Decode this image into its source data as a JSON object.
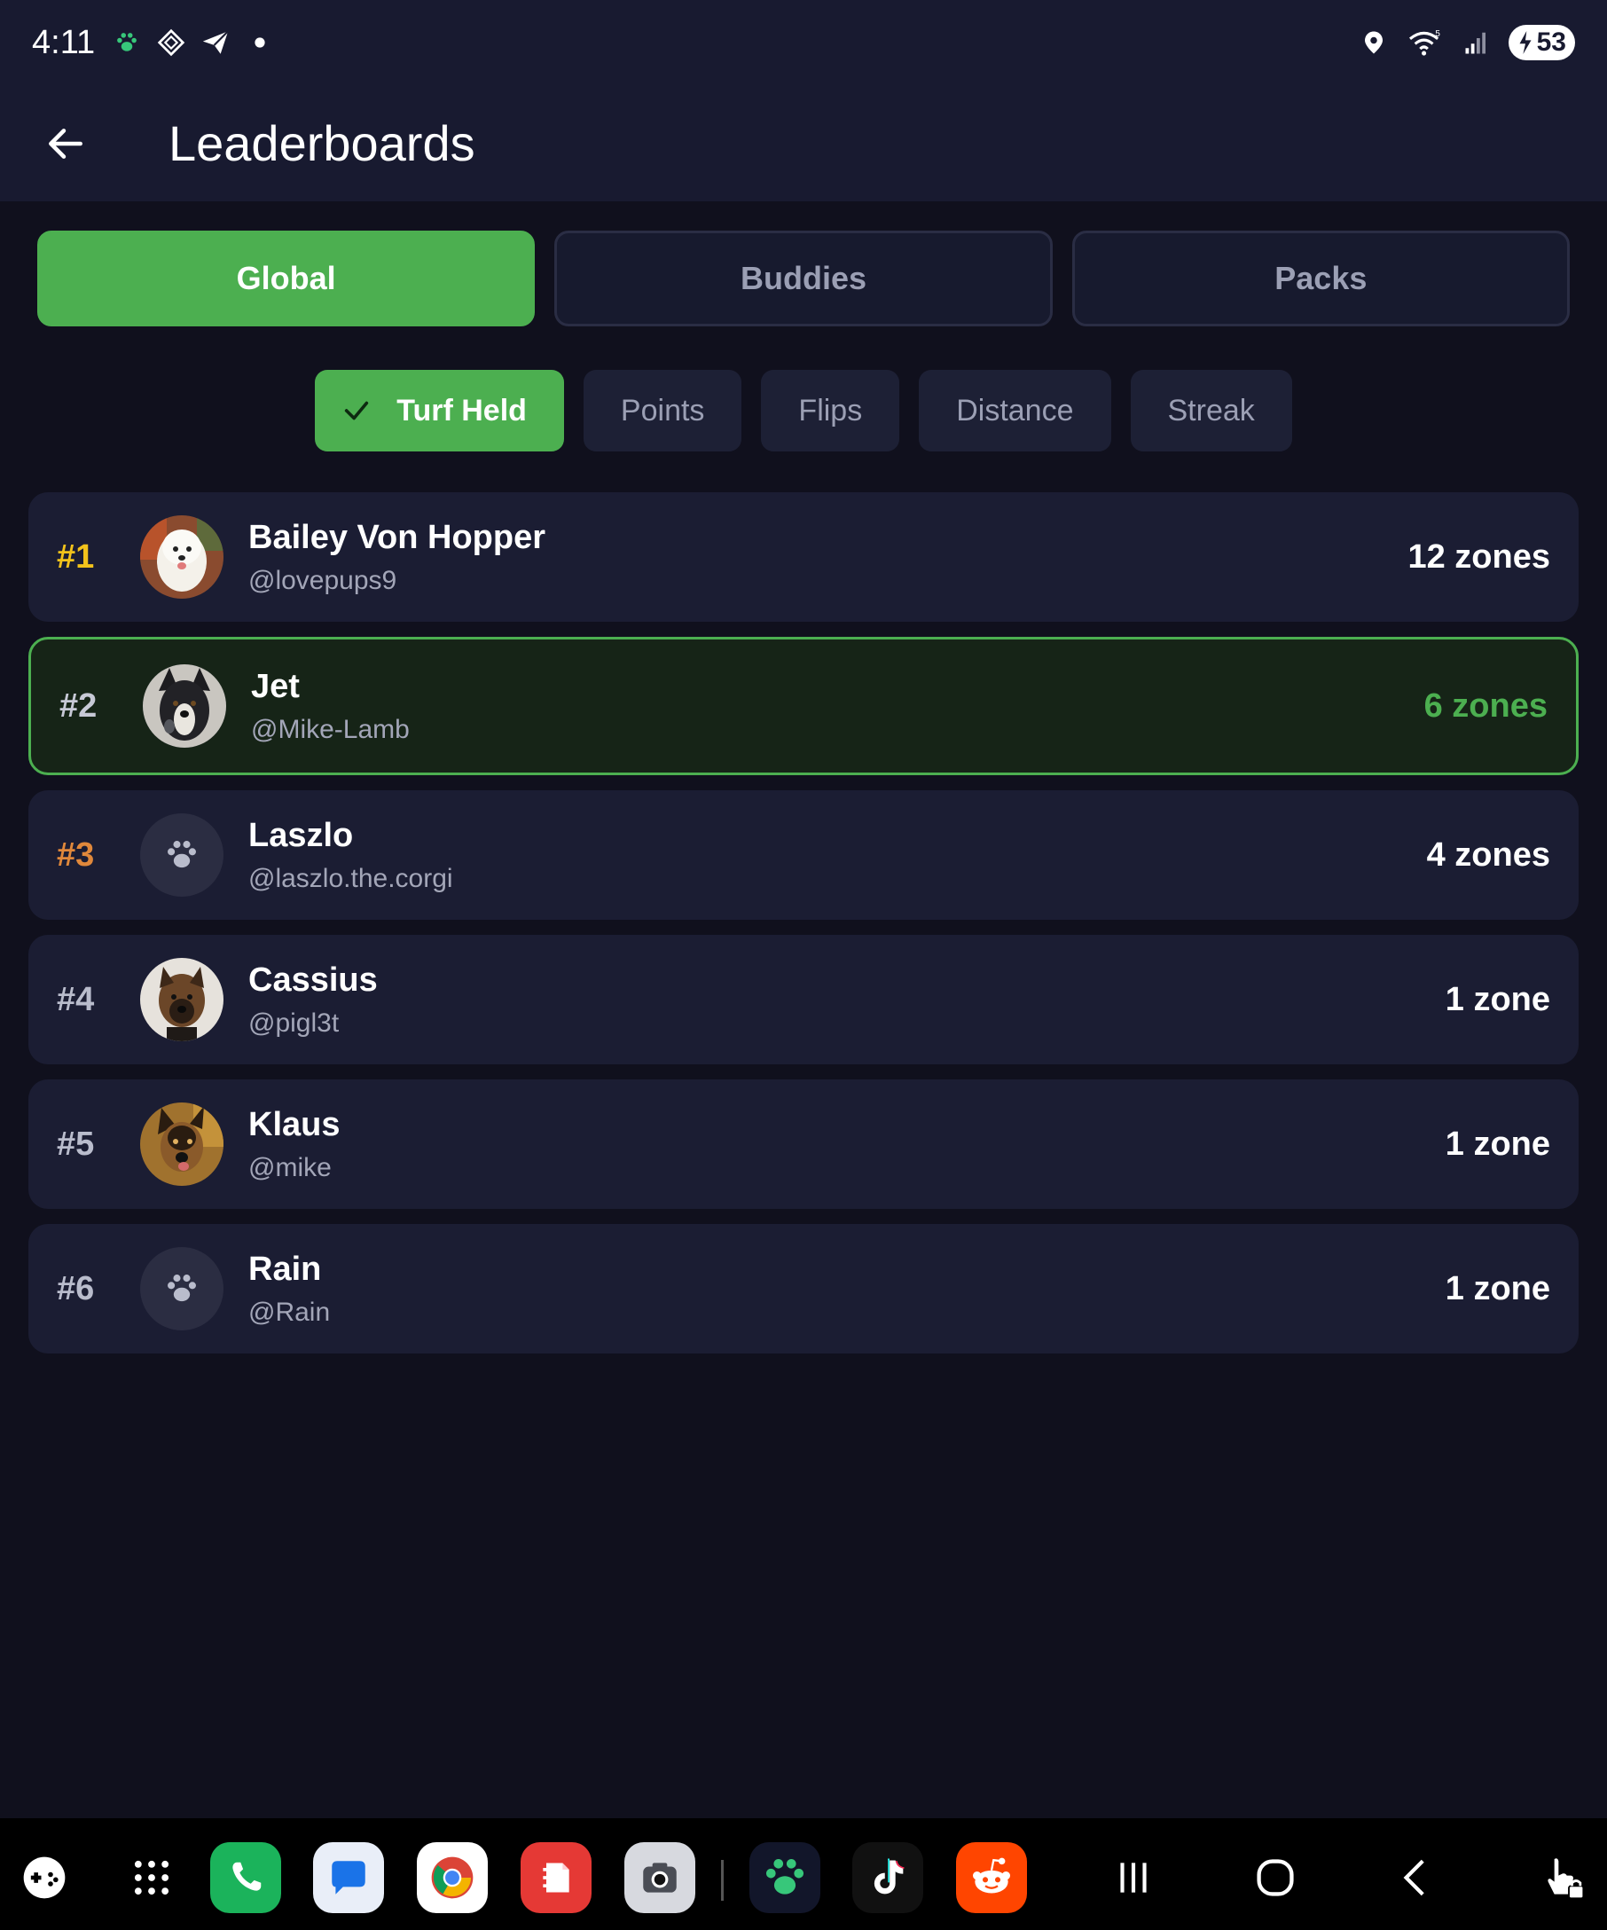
{
  "status_bar": {
    "time": "4:11",
    "battery": "53",
    "wifi_label": "5",
    "left_icons": [
      "paw-icon",
      "diamond-icon",
      "telegram-icon",
      "dot-icon"
    ],
    "right_icons": [
      "location-icon",
      "wifi-icon",
      "signal-icon",
      "battery-icon"
    ]
  },
  "header": {
    "title": "Leaderboards"
  },
  "segments": [
    {
      "label": "Global",
      "active": true
    },
    {
      "label": "Buddies",
      "active": false
    },
    {
      "label": "Packs",
      "active": false
    }
  ],
  "filters": [
    {
      "label": "Turf Held",
      "active": true
    },
    {
      "label": "Points",
      "active": false
    },
    {
      "label": "Flips",
      "active": false
    },
    {
      "label": "Distance",
      "active": false
    },
    {
      "label": "Streak",
      "active": false
    }
  ],
  "leaderboard": [
    {
      "rank": "#1",
      "name": "Bailey Von Hopper",
      "handle": "@lovepups9",
      "score": "12 zones",
      "avatar": "photo-white-dog",
      "rank_color": "#f2c21b"
    },
    {
      "rank": "#2",
      "name": "Jet",
      "handle": "@Mike-Lamb",
      "score": "6 zones",
      "avatar": "photo-black-dog",
      "rank_color": "#c7c9d6",
      "is_current_user": true
    },
    {
      "rank": "#3",
      "name": "Laszlo",
      "handle": "@laszlo.the.corgi",
      "score": "4 zones",
      "avatar": "paw-placeholder",
      "rank_color": "#e0883b"
    },
    {
      "rank": "#4",
      "name": "Cassius",
      "handle": "@pigl3t",
      "score": "1 zone",
      "avatar": "photo-brown-dog",
      "rank_color": "#b9bccc"
    },
    {
      "rank": "#5",
      "name": "Klaus",
      "handle": "@mike",
      "score": "1 zone",
      "avatar": "photo-shepherd",
      "rank_color": "#b9bccc"
    },
    {
      "rank": "#6",
      "name": "Rain",
      "handle": "@Rain",
      "score": "1 zone",
      "avatar": "paw-placeholder",
      "rank_color": "#b9bccc"
    }
  ],
  "colors": {
    "accent": "#4caf50",
    "background": "#10101d",
    "card": "#1b1d33",
    "highlight_card": "#162417"
  },
  "nav_bar": {
    "apps": [
      "game-launcher-icon",
      "app-drawer-icon",
      "phone-app-icon",
      "messages-app-icon",
      "chrome-app-icon",
      "notes-app-icon",
      "camera-app-icon",
      "paw-app-icon",
      "tiktok-app-icon",
      "reddit-app-icon"
    ],
    "system": [
      "recents-icon",
      "home-icon",
      "back-nav-icon",
      "touch-lock-icon"
    ]
  }
}
